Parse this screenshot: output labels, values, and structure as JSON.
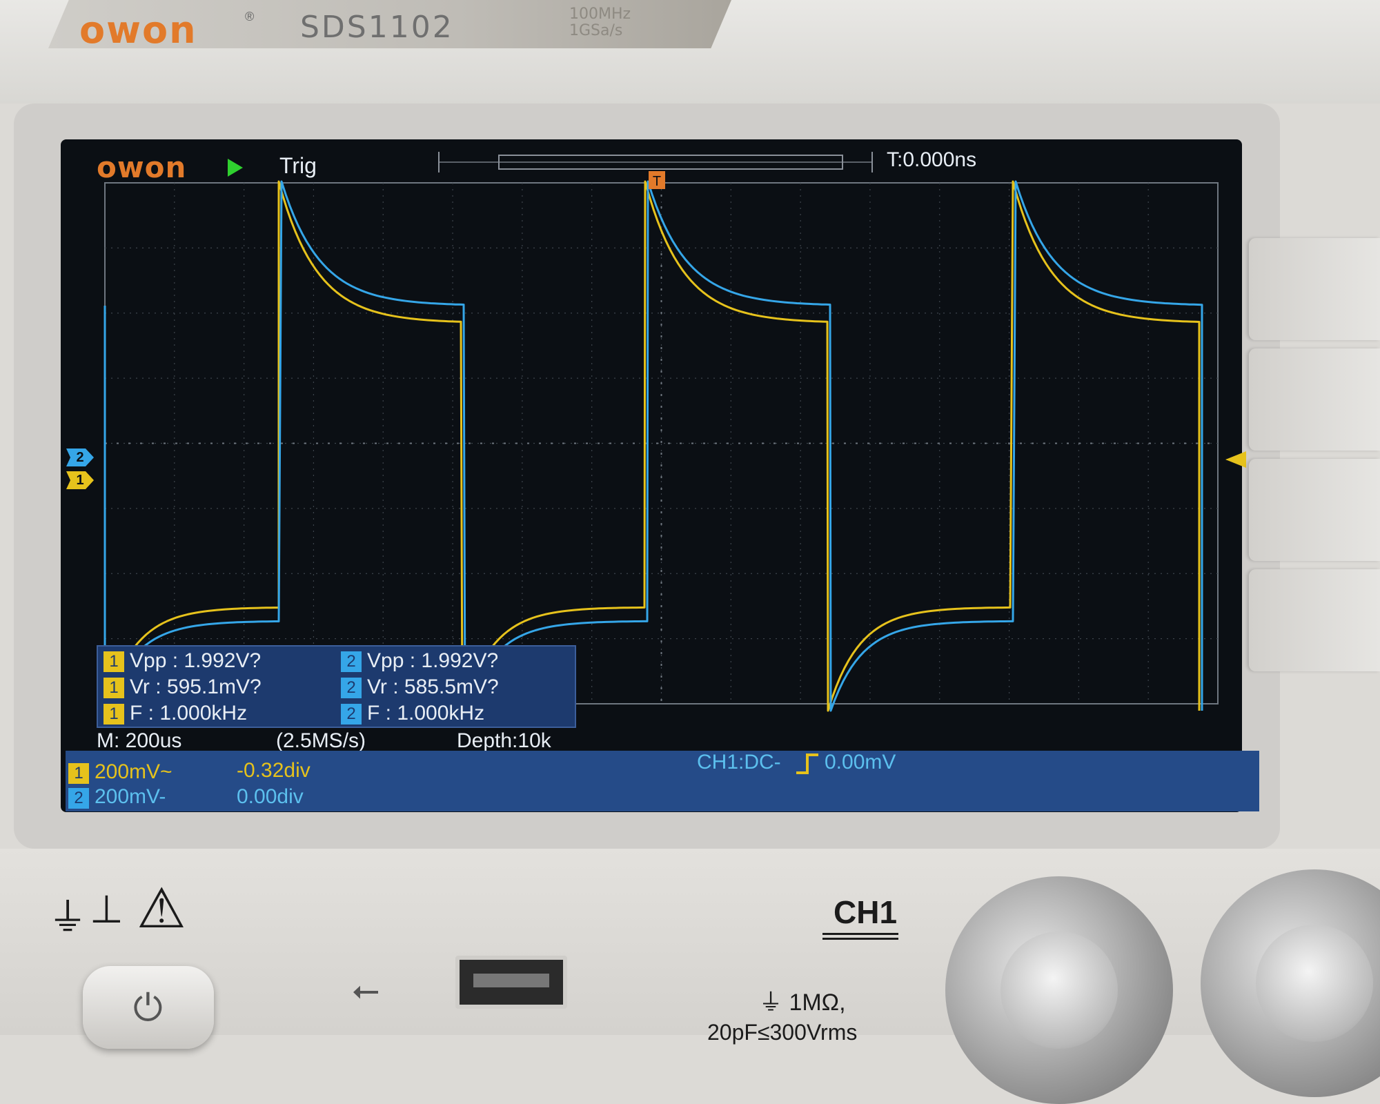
{
  "device": {
    "brand": "owon",
    "registered_mark": "®",
    "model": "SDS1102",
    "spec_bandwidth": "100MHz",
    "spec_sample_rate": "1GSa/s"
  },
  "screen": {
    "logo": "owon",
    "run_state": "Trig",
    "time_offset": "T:0.000ns",
    "trigger_marker": "T",
    "channel_markers": {
      "ch1": "1",
      "ch2": "2"
    }
  },
  "measurements": [
    {
      "channel": "1",
      "label": "Vpp : 1.992V?"
    },
    {
      "channel": "2",
      "label": "Vpp : 1.992V?"
    },
    {
      "channel": "1",
      "label": "Vr : 595.1mV?"
    },
    {
      "channel": "2",
      "label": "Vr : 585.5mV?"
    },
    {
      "channel": "1",
      "label": "F : 1.000kHz"
    },
    {
      "channel": "2",
      "label": "F : 1.000kHz"
    }
  ],
  "status": {
    "timebase": "M: 200us",
    "sample_rate": "(2.5MS/s)",
    "depth": "Depth:10k"
  },
  "channels": {
    "ch1": {
      "badge": "1",
      "scale": "200mV~",
      "offset": "-0.32div"
    },
    "ch2": {
      "badge": "2",
      "scale": "200mV-",
      "offset": "0.00div"
    },
    "trigger": "CH1:DC-",
    "trigger_level": "0.00mV"
  },
  "front_panel": {
    "ch1_label": "CH1",
    "ch1_spec_line1": "1MΩ,",
    "ch1_spec_line2": "20pF≤300Vrms"
  },
  "colors": {
    "ch1_trace": "#e6c21c",
    "ch2_trace": "#35a6e8",
    "screen_bg": "#0b0f14",
    "status_bar": "#254b88",
    "logo_orange": "#e27a2a"
  },
  "icons": {
    "run": "play-icon",
    "power": "power-icon",
    "usb": "usb-icon",
    "warning": "warning-icon",
    "ground": "ground-icon"
  }
}
